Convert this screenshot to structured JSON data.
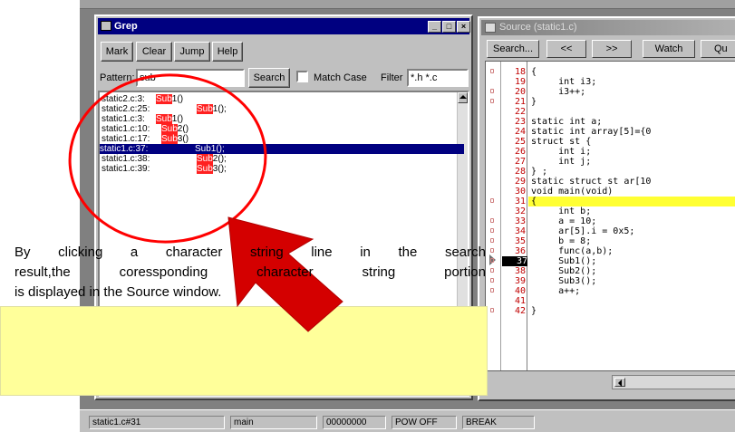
{
  "grep": {
    "title": "Grep",
    "buttons": [
      "Mark",
      "Clear",
      "Jump",
      "Help"
    ],
    "pattern_label": "Pattern:",
    "pattern_value": "sub",
    "search_label": "Search",
    "match_case_label": "Match Case",
    "filter_label": "Filter",
    "filter_value": "*.h *.c",
    "results": [
      {
        "file": "static2.c:3:",
        "pre": "",
        "hit": "Sub",
        "post": "1()"
      },
      {
        "file": "static2.c:25:",
        "pre": "",
        "hit": "Sub",
        "post": "1();"
      },
      {
        "file": "static1.c:3:",
        "pre": "",
        "hit": "Sub",
        "post": "1()"
      },
      {
        "file": "static1.c:10:",
        "pre": "",
        "hit": "Sub",
        "post": "2()"
      },
      {
        "file": "static1.c:17:",
        "pre": "",
        "hit": "Sub",
        "post": "3()"
      },
      {
        "file": "static1.c:37:",
        "pre": "",
        "hit": "",
        "post": "Sub1();"
      },
      {
        "file": "static1.c:38:",
        "pre": "",
        "hit": "Sub",
        "post": "2();"
      },
      {
        "file": "static1.c:39:",
        "pre": "",
        "hit": "Sub",
        "post": "3();"
      }
    ],
    "selected_row": 5
  },
  "source": {
    "title": "Source (static1.c)",
    "buttons": [
      "Search...",
      "<<",
      ">>",
      "Watch",
      "Qu"
    ],
    "lines": [
      {
        "no": "18",
        "code": "{",
        "mark": true
      },
      {
        "no": "19",
        "code": "     int i3;",
        "mark": false
      },
      {
        "no": "20",
        "code": "     i3++;",
        "mark": true
      },
      {
        "no": "21",
        "code": "}",
        "mark": true
      },
      {
        "no": "22",
        "code": "",
        "mark": false
      },
      {
        "no": "23",
        "code": "static int a;",
        "mark": false
      },
      {
        "no": "24",
        "code": "static int array[5]={0",
        "mark": false
      },
      {
        "no": "25",
        "code": "struct st {",
        "mark": false
      },
      {
        "no": "26",
        "code": "     int i;",
        "mark": false
      },
      {
        "no": "27",
        "code": "     int j;",
        "mark": false
      },
      {
        "no": "28",
        "code": "} ;",
        "mark": false
      },
      {
        "no": "29",
        "code": "static struct st ar[10",
        "mark": false
      },
      {
        "no": "30",
        "code": "void main(void)",
        "mark": false
      },
      {
        "no": "31",
        "code": "{",
        "mark": true
      },
      {
        "no": "32",
        "code": "     int b;",
        "mark": false
      },
      {
        "no": "33",
        "code": "     a = 10;",
        "mark": true
      },
      {
        "no": "34",
        "code": "     ar[5].i = 0x5;",
        "mark": true
      },
      {
        "no": "35",
        "code": "     b = 8;",
        "mark": true
      },
      {
        "no": "36",
        "code": "     func(a,b);",
        "mark": true
      },
      {
        "no": "37",
        "code": "     Sub1();",
        "mark": true
      },
      {
        "no": "38",
        "code": "     Sub2();",
        "mark": true
      },
      {
        "no": "39",
        "code": "     Sub3();",
        "mark": true
      },
      {
        "no": "40",
        "code": "     a++;",
        "mark": true
      },
      {
        "no": "41",
        "code": "",
        "mark": false
      },
      {
        "no": "42",
        "code": "}",
        "mark": true
      }
    ],
    "highlight_line": "31",
    "pc_line": "37"
  },
  "status": {
    "panels": [
      "static1.c#31",
      "main",
      "00000000",
      "POW OFF",
      "BREAK"
    ]
  },
  "annotation": {
    "lines": [
      "By clicking a character string line in the search",
      "result,the coressponding character string portion",
      "is displayed in the Source window."
    ]
  },
  "colors": {
    "title_active": "#000080",
    "match_highlight": "#ff2020",
    "selection": "#000080",
    "current_line": "#ffff33",
    "callout_fill": "#ffff9a",
    "circle_stroke": "#ff0000",
    "arrow_fill": "#d40000"
  }
}
